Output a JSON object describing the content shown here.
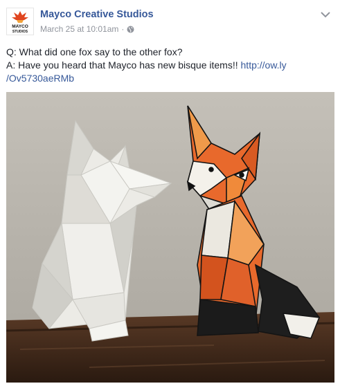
{
  "post": {
    "author": "Mayco Creative Studios",
    "avatar_text": {
      "line1": "MAYCO",
      "line2": "STUDIOS"
    },
    "timestamp": "March 25 at 10:01am",
    "separator": "·",
    "privacy_icon": "globe-icon",
    "menu_icon": "chevron-down-icon",
    "text": {
      "question": "Q: What did one fox say to the other fox?",
      "answer_prefix": "A: Have you heard that Mayco has new bisque items!! ",
      "link_line1": "http://ow.ly",
      "link_line2": "/Ov5730aeRMb"
    },
    "photo": {
      "subject": "two faceted ceramic fox figurines",
      "colors": {
        "background": "#b9b5ad",
        "wood": "#3a2418",
        "bisque": "#ecebe6",
        "orange": "#e8682a",
        "black": "#1b1b1b"
      }
    }
  },
  "colors": {
    "link": "#365899",
    "meta": "#90949c",
    "text": "#1d2129"
  }
}
